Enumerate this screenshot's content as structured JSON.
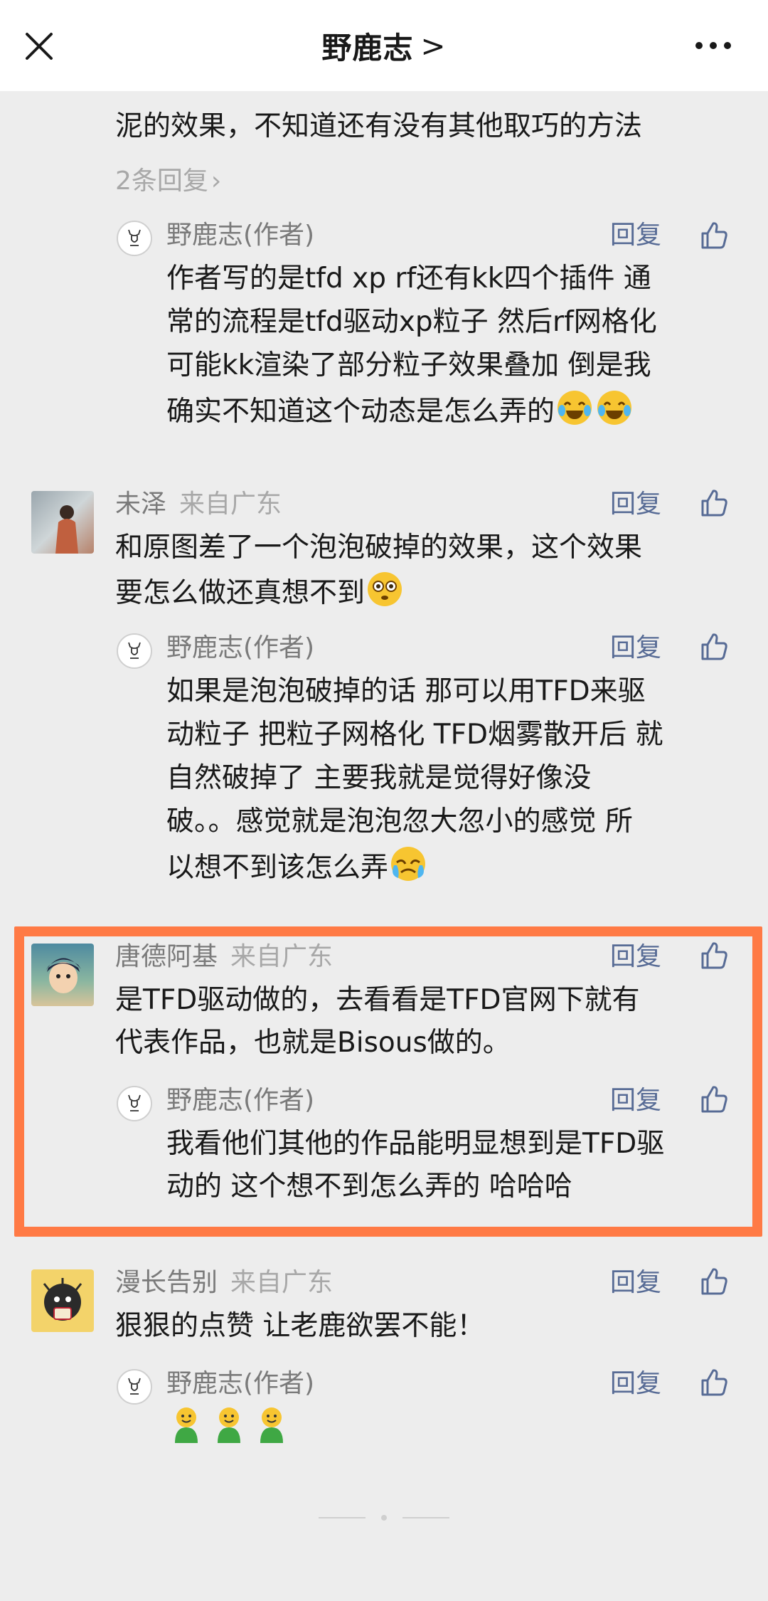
{
  "header": {
    "title": "野鹿志",
    "chevron": ">"
  },
  "comment0": {
    "partial_line": "泥的效果，不知道还有没有其他取巧的方法",
    "more_replies": "2条回复",
    "reply": {
      "name": "野鹿志(作者)",
      "reply_label": "回复",
      "lines": [
        "作者写的是tfd xp rf还有kk四个插件 通",
        "常的流程是tfd驱动xp粒子 然后rf网格化",
        "可能kk渲染了部分粒子效果叠加 倒是我",
        "确实不知道这个动态是怎么弄的"
      ]
    }
  },
  "comment1": {
    "name": "未泽",
    "location": "来自广东",
    "reply_label": "回复",
    "lines": [
      "和原图差了一个泡泡破掉的效果，这个效果",
      "要怎么做还真想不到"
    ],
    "reply": {
      "name": "野鹿志(作者)",
      "reply_label": "回复",
      "lines": [
        "如果是泡泡破掉的话 那可以用TFD来驱",
        "动粒子 把粒子网格化 TFD烟雾散开后 就",
        "自然破掉了 主要我就是觉得好像没",
        "破。。感觉就是泡泡忽大忽小的感觉 所",
        "以想不到该怎么弄"
      ]
    }
  },
  "comment2": {
    "name": "唐德阿基",
    "location": "来自广东",
    "reply_label": "回复",
    "lines": [
      "是TFD驱动做的，去看看是TFD官网下就有",
      "代表作品，也就是Bisous做的。"
    ],
    "reply": {
      "name": "野鹿志(作者)",
      "reply_label": "回复",
      "lines": [
        "我看他们其他的作品能明显想到是TFD驱",
        "动的 这个想不到怎么弄的 哈哈哈"
      ]
    }
  },
  "comment3": {
    "name": "漫长告别",
    "location": "来自广东",
    "reply_label": "回复",
    "lines": [
      "狠狠的点赞 让老鹿欲罢不能！"
    ],
    "reply": {
      "name": "野鹿志(作者)",
      "reply_label": "回复"
    }
  },
  "colors": {
    "link": "#576b95",
    "highlight": "#ff7a45",
    "background": "#ededed"
  },
  "icons": [
    "close-icon",
    "chevron-right-icon",
    "more-icon",
    "thumbs-up-icon",
    "deer-logo-icon"
  ]
}
